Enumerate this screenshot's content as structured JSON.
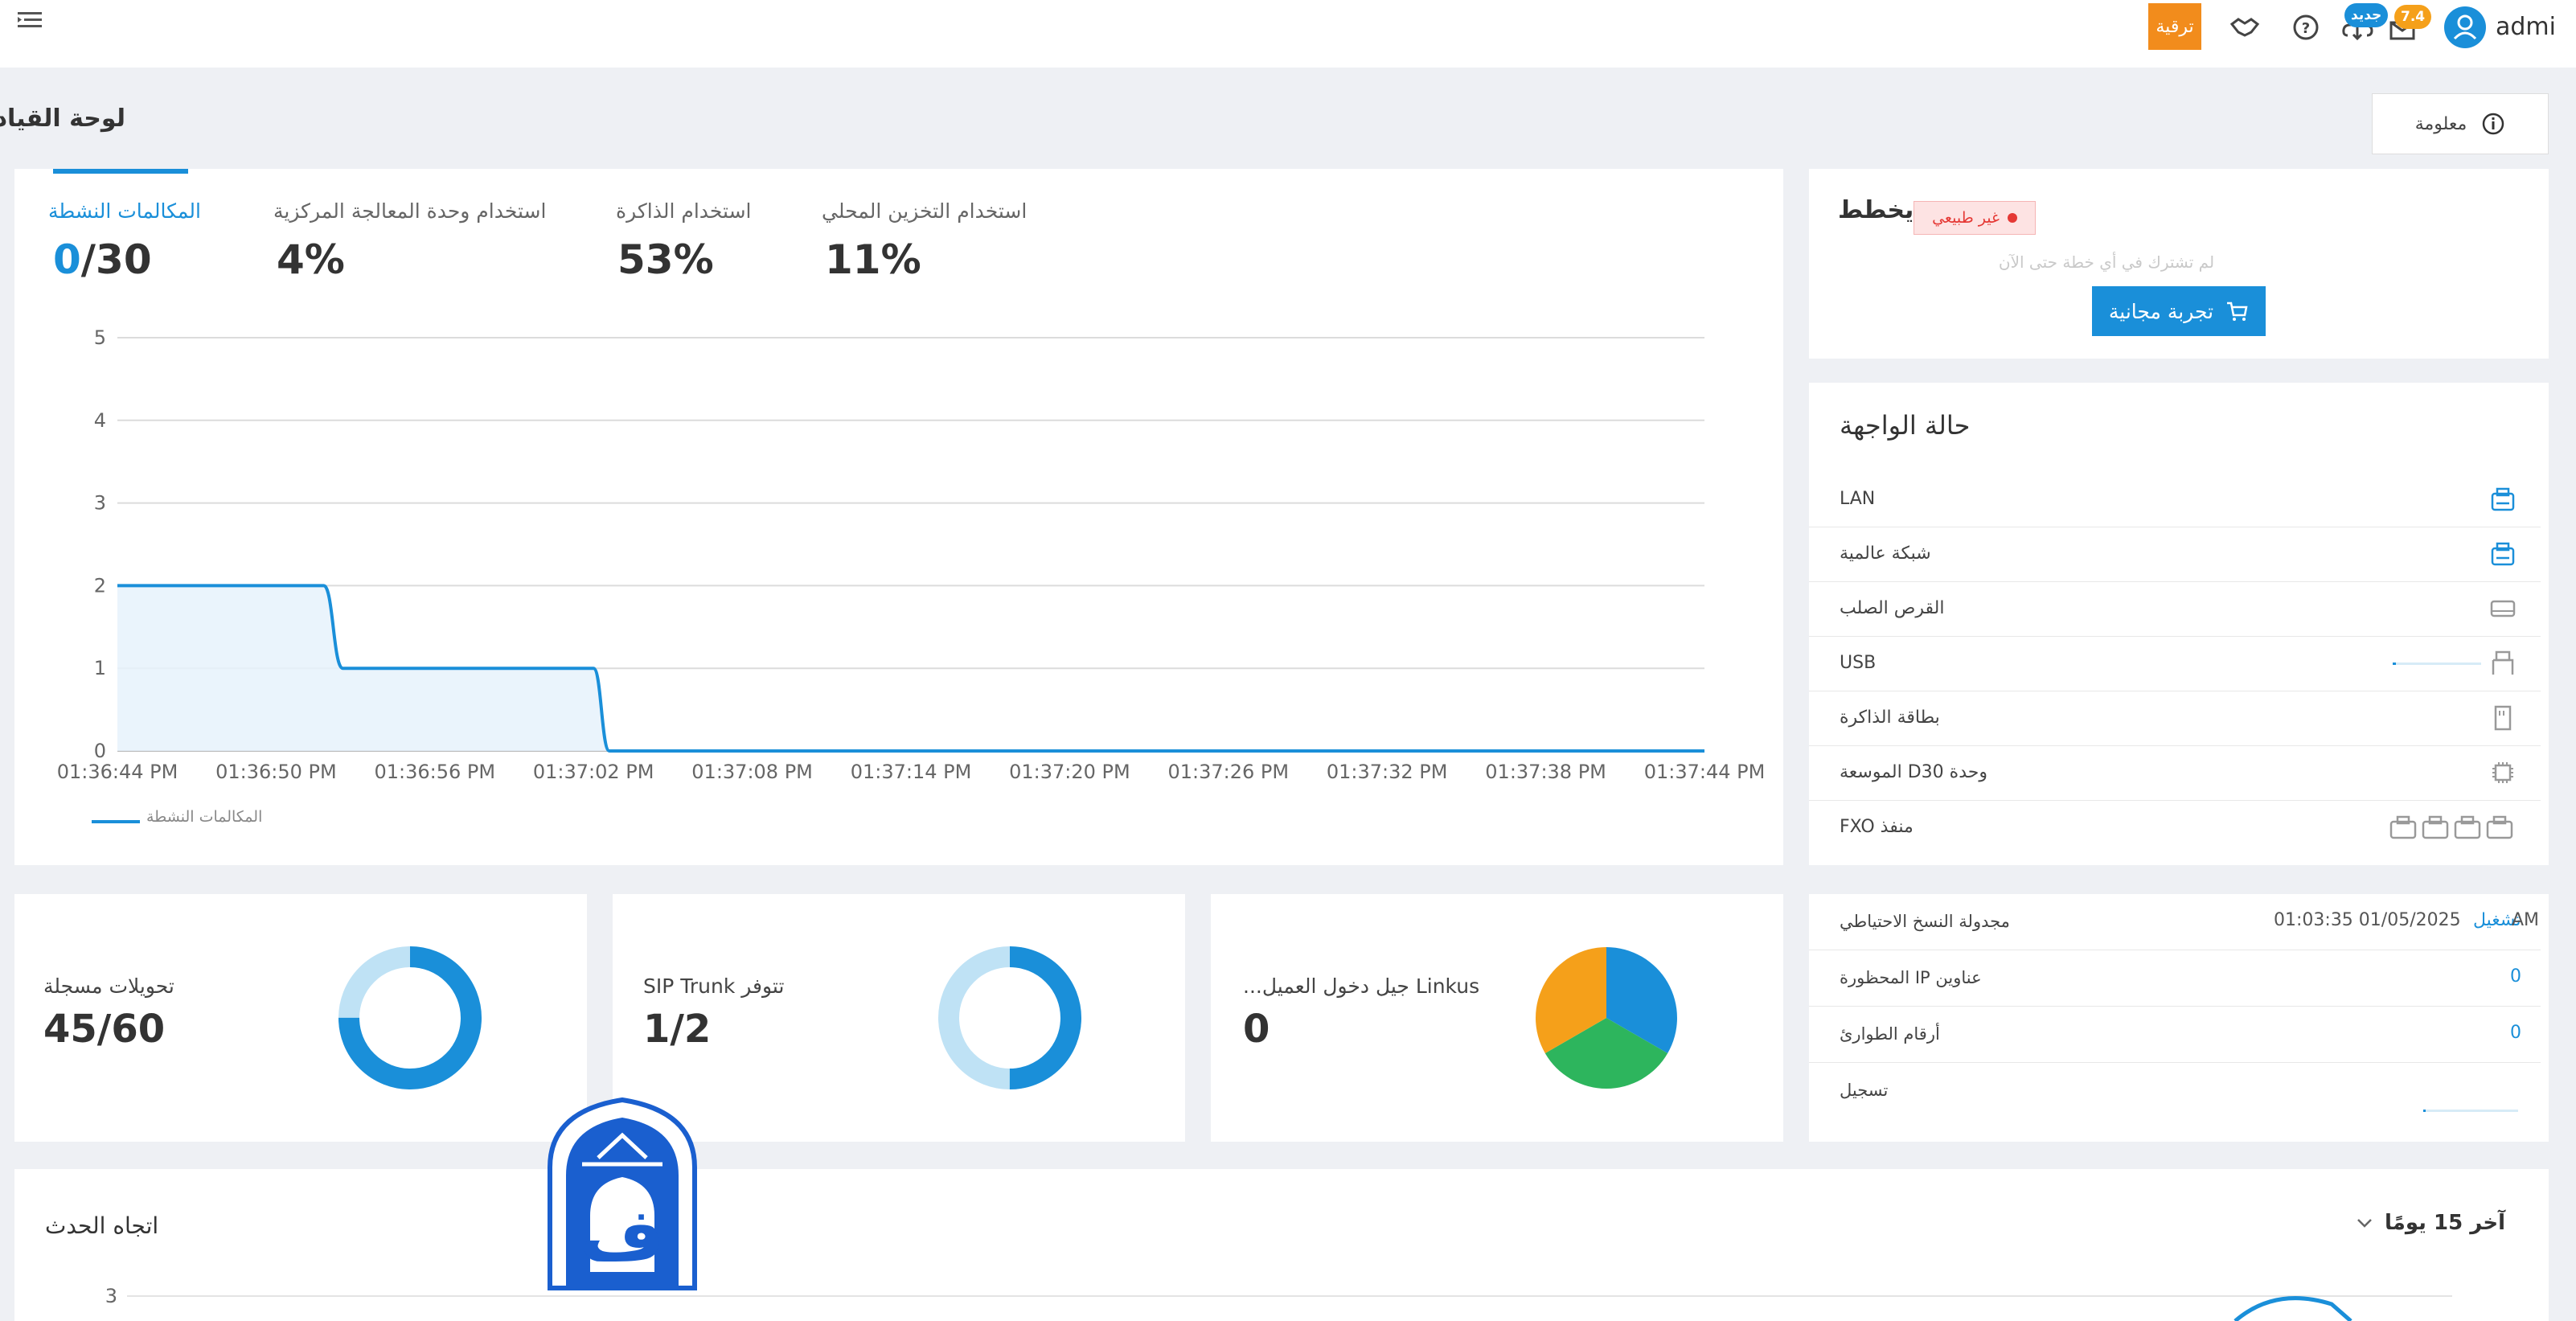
{
  "topbar": {
    "upgrade_label": "ترقية",
    "badge_new": "جديد",
    "badge_version": "7.4",
    "user": "admi",
    "icons": [
      "menu-icon",
      "handshake-icon",
      "help-icon",
      "cloud-update-icon",
      "mailbox-icon",
      "user-avatar-icon"
    ]
  },
  "page": {
    "title": "لوحة القيادة",
    "info_label": "معلومة"
  },
  "stats": [
    {
      "label": "المكالمات النشطة",
      "value": "0/30"
    },
    {
      "label": "استخدام وحدة المعالجة المركزية",
      "value": "4%"
    },
    {
      "label": "استخدام الذاكرة",
      "value": "53%"
    },
    {
      "label": "استخدام التخزين المحلي",
      "value": "11%"
    }
  ],
  "plan": {
    "title": "يخطط",
    "status": "غير طبيعي",
    "note": "لم تشترك في أي خطة حتى الآن",
    "trial_label": "تجربة مجانية"
  },
  "interface": {
    "title": "حالة الواجهة",
    "rows": [
      {
        "label": "LAN",
        "icon": "lan-port-icon"
      },
      {
        "label": "شبكة عالمية",
        "icon": "wan-port-icon"
      },
      {
        "label": "القرص الصلب",
        "icon": "hard-disk-icon"
      },
      {
        "label": "USB",
        "icon": "usb-icon"
      },
      {
        "label": "بطاقة الذاكرة",
        "icon": "sd-card-icon"
      },
      {
        "label": "الموسعة D30 وحدة",
        "icon": "module-icon"
      },
      {
        "label": "FXO منفذ",
        "icon": "fxo-port-icon"
      }
    ]
  },
  "small_cards": [
    {
      "label": "تحويلات مسجلة",
      "value": "45/60",
      "fraction": 0.75
    },
    {
      "label": "SIP Trunk تتوفر",
      "value": "1/2",
      "fraction": 0.5
    },
    {
      "label": "...جيل دخول العميل Linkus",
      "value": "0"
    }
  ],
  "backup": {
    "rows": [
      {
        "label": "مجدولة النسخ الاحتياطي",
        "value": "01:03:35 01/05/2025",
        "value_link": "تشغيل",
        "value_suffix": "AM"
      },
      {
        "label": "المحظورة IP عناوين",
        "value": "0"
      },
      {
        "label": "أرقام الطوارئ",
        "value": "0"
      },
      {
        "label": "تسجيل",
        "value": ""
      }
    ]
  },
  "trend": {
    "title": "اتجاه الحدث",
    "range": "آخر 15 يومًا",
    "y_tick": "3"
  },
  "colors": {
    "accent": "#1a8fd9",
    "orange": "#f28c1c",
    "green": "#2db55d",
    "pie_orange": "#f5a01a",
    "ring_light": "#bfe2f5"
  },
  "chart_data": {
    "type": "line",
    "x": [
      "01:36:44 PM",
      "01:36:50 PM",
      "01:36:56 PM",
      "01:37:02 PM",
      "01:37:08 PM",
      "01:37:14 PM",
      "01:37:20 PM",
      "01:37:26 PM",
      "01:37:32 PM",
      "01:37:38 PM",
      "01:37:44 PM"
    ],
    "series": [
      {
        "name": "المكالمات النشطة",
        "points": [
          [
            0,
            2
          ],
          [
            1.3,
            2
          ],
          [
            1.42,
            1
          ],
          [
            3.0,
            1
          ],
          [
            3.1,
            0
          ],
          [
            10,
            0
          ]
        ]
      }
    ],
    "yticks": [
      0,
      1,
      2,
      3,
      4,
      5
    ],
    "ylim": [
      0,
      5
    ],
    "grid": true,
    "legend": "bottom-left",
    "area": true
  }
}
